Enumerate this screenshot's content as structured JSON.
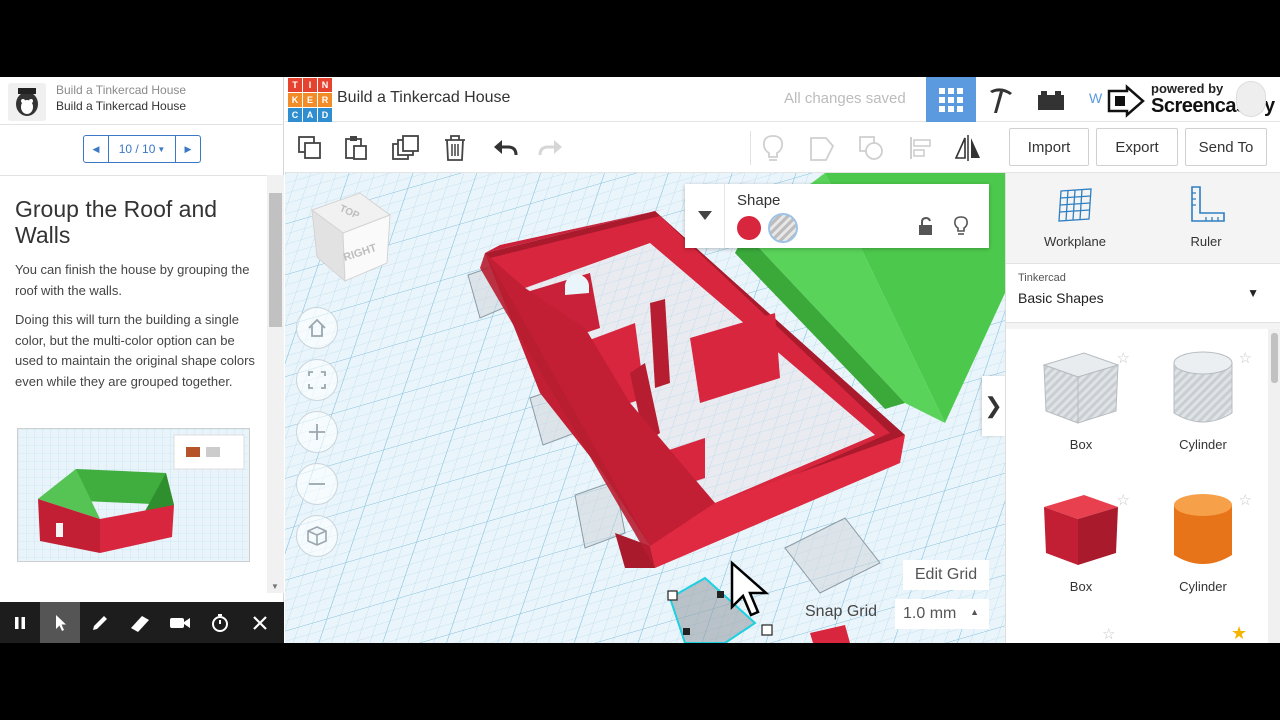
{
  "lesson": {
    "crumb_parent": "Build a Tinkercad House",
    "crumb_current": "Build a Tinkercad House",
    "pager": "10 / 10",
    "title": "Group the Roof and Walls",
    "para1": "You can finish the house by grouping the roof with the walls.",
    "para2": "Doing this will turn the building a single color, but the multi-color option can be used to maintain the original shape colors even while they are grouped together."
  },
  "screencast_bar": {
    "icons": [
      "pause-icon",
      "pointer-icon",
      "pen-icon",
      "highlighter-icon",
      "camera-icon",
      "timer-icon",
      "close-icon"
    ],
    "active_tool": "pointer-icon"
  },
  "topbar": {
    "logo_letters": [
      "T",
      "I",
      "N",
      "K",
      "E",
      "R",
      "C",
      "A",
      "D"
    ],
    "logo_colors": [
      "#e5432f",
      "#e5432f",
      "#e5432f",
      "#f28c28",
      "#f28c28",
      "#f28c28",
      "#2e8ecf",
      "#2e8ecf",
      "#2e8ecf"
    ],
    "doc_title": "Build a Tinkercad House",
    "save_status": "All changes saved",
    "active_view": "3d-design",
    "accent": "#5b9ade"
  },
  "watermark": {
    "cut_text": "W",
    "small": "powered by",
    "big": "Screencastify"
  },
  "toolbar": {
    "left_tools": [
      "copy-icon",
      "paste-icon",
      "duplicate-icon",
      "delete-icon",
      "undo-icon",
      "redo-icon"
    ],
    "right_tools": [
      "note-icon",
      "group-icon",
      "ungroup-icon",
      "align-icon",
      "mirror-icon"
    ],
    "import": "Import",
    "export": "Export",
    "send_to": "Send To"
  },
  "viewcube": {
    "top": "TOP",
    "right": "RIGHT"
  },
  "shape_inspector": {
    "title": "Shape",
    "solid_color": "#d7263d"
  },
  "grid": {
    "edit_grid": "Edit Grid",
    "snap_label": "Snap Grid",
    "snap_value": "1.0 mm"
  },
  "shapes_panel": {
    "workplane": "Workplane",
    "ruler": "Ruler",
    "library_group": "Tinkercad",
    "library_name": "Basic Shapes",
    "items": [
      {
        "label": "Box",
        "kind": "hole"
      },
      {
        "label": "Cylinder",
        "kind": "hole"
      },
      {
        "label": "Box",
        "kind": "solid",
        "color": "#d7263d"
      },
      {
        "label": "Cylinder",
        "kind": "solid",
        "color": "#f27d1a"
      }
    ]
  },
  "colors": {
    "wall_red": "#d7263d",
    "roof_green": "#4cc94c",
    "hole_gray": "#cfd4d8"
  }
}
